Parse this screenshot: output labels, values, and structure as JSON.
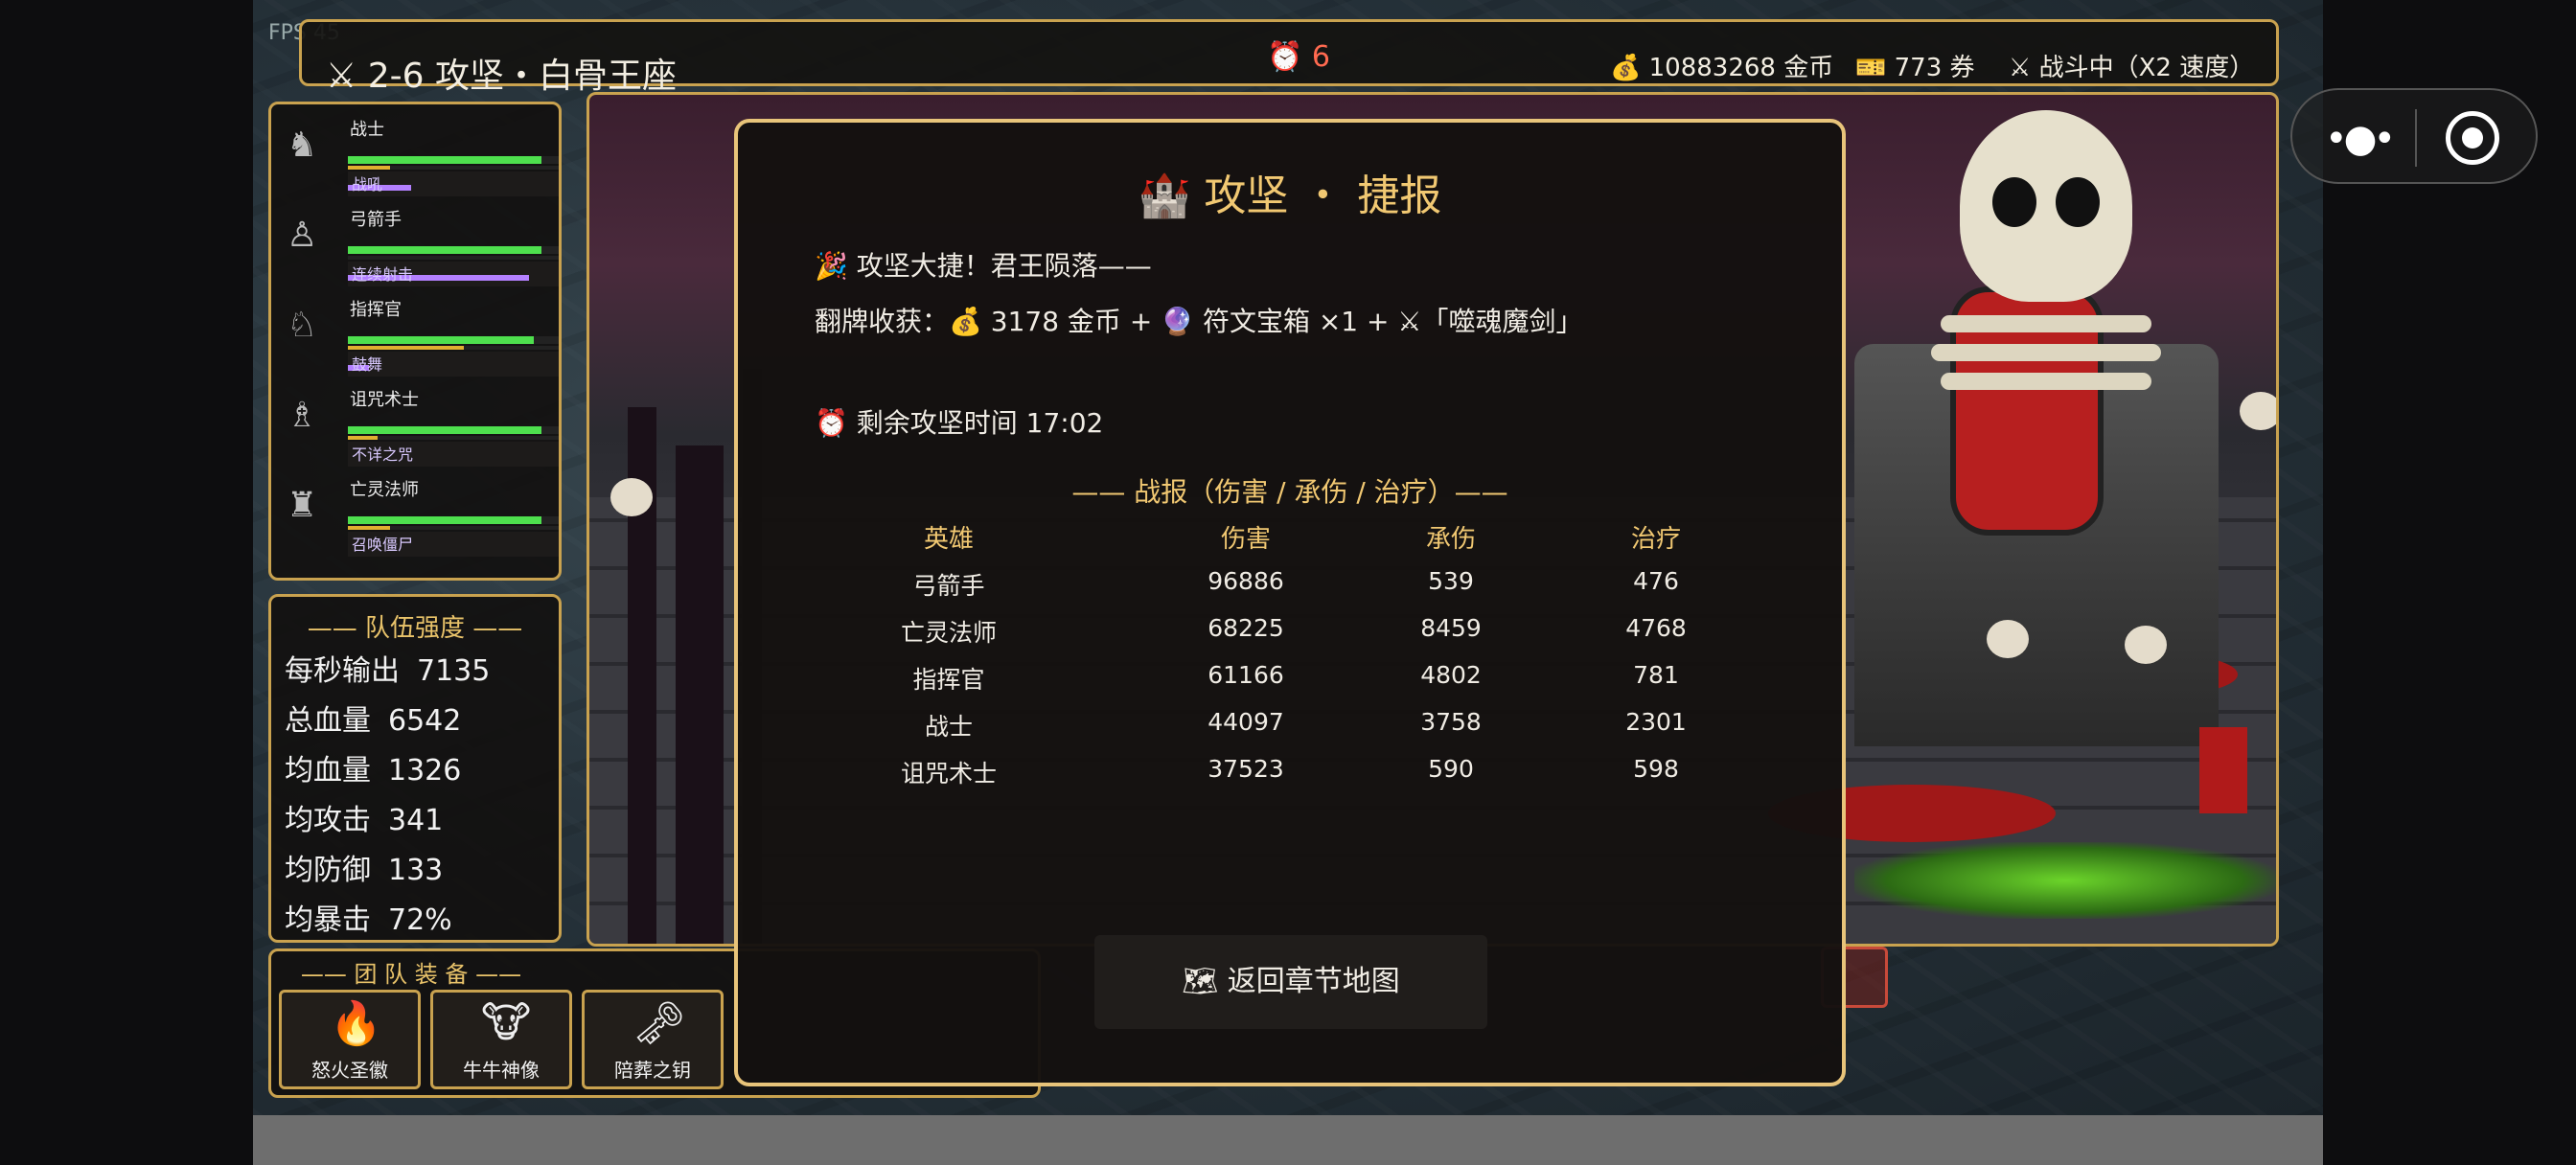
{
  "fps": "FPS 45",
  "topbar": {
    "stage": "⚔ 2-6 攻坚・白骨王座",
    "timer": "⏰ 6",
    "gold": "💰 10883268 金币",
    "tickets": "🎫 773 券",
    "status": "⚔ 战斗中（X2 速度）"
  },
  "heroes": [
    {
      "name": "战士",
      "icon": "knight-icon",
      "hp": 0.92,
      "energy": 0.2,
      "skill": "战吼",
      "skill_fill": 0.3
    },
    {
      "name": "弓箭手",
      "icon": "archer-icon",
      "hp": 0.92,
      "energy": 0.0,
      "skill": "连续射击",
      "skill_fill": 0.86
    },
    {
      "name": "指挥官",
      "icon": "commander-icon",
      "hp": 0.88,
      "energy": 0.55,
      "skill": "鼓舞",
      "skill_fill": 0.1
    },
    {
      "name": "诅咒术士",
      "icon": "warlock-icon",
      "hp": 0.92,
      "energy": 0.14,
      "skill": "不详之咒",
      "skill_fill": 0.0
    },
    {
      "name": "亡灵法师",
      "icon": "necromancer-icon",
      "hp": 0.92,
      "energy": 0.2,
      "skill": "召唤僵尸",
      "skill_fill": 0.0
    }
  ],
  "strength": {
    "title": "—— 队伍强度 ——",
    "rows": [
      {
        "label": "每秒输出",
        "value": "7135"
      },
      {
        "label": "总血量",
        "value": "6542"
      },
      {
        "label": "均血量",
        "value": "1326"
      },
      {
        "label": "均攻击",
        "value": "341"
      },
      {
        "label": "均防御",
        "value": "133"
      },
      {
        "label": "均暴击",
        "value": "72%"
      }
    ]
  },
  "equipment": {
    "title": "—— 团 队 装 备 ——",
    "items": [
      {
        "name": "怒火圣徽",
        "icon": "🔥"
      },
      {
        "name": "牛牛神像",
        "icon": "🐮"
      },
      {
        "name": "陪葬之钥",
        "icon": "🗝"
      }
    ]
  },
  "modal": {
    "title": "🏰 攻坚 ・ 捷报",
    "line1": "🎉 攻坚大捷！君王陨落——",
    "line2": "翻牌收获：💰 3178 金币 + 🔮 符文宝箱 ×1 + ⚔「噬魂魔剑」",
    "line3": "⏰ 剩余攻坚时间 17:02",
    "report_title": "—— 战报（伤害 / 承伤 / 治疗）——",
    "columns": [
      "英雄",
      "伤害",
      "承伤",
      "治疗"
    ],
    "rows": [
      [
        "弓箭手",
        "96886",
        "539",
        "476"
      ],
      [
        "亡灵法师",
        "68225",
        "8459",
        "4768"
      ],
      [
        "指挥官",
        "61166",
        "4802",
        "781"
      ],
      [
        "战士",
        "44097",
        "3758",
        "2301"
      ],
      [
        "诅咒术士",
        "37523",
        "590",
        "598"
      ]
    ],
    "back_button": "🗺 返回章节地图"
  },
  "colors": {
    "gold_border": "#c9a24f",
    "hp": "#4ee04e",
    "energy": "#e0b030",
    "skill": "#b380ff",
    "title": "#f1c872"
  }
}
